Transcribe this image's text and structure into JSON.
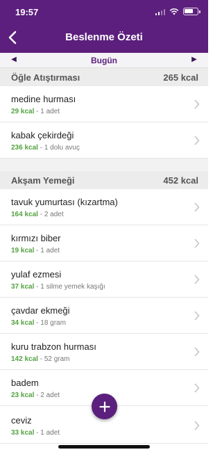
{
  "status_bar": {
    "time": "19:57",
    "battery_level": 0.7
  },
  "nav": {
    "title": "Beslenme Özeti",
    "back_icon": "chevron-left-icon"
  },
  "date_bar": {
    "label": "Bugün",
    "prev_icon": "triangle-left-icon",
    "next_icon": "triangle-right-icon"
  },
  "sections": [
    {
      "name": "Öğle Atıştırması",
      "kcal": "265 kcal",
      "items": [
        {
          "name": "medine hurması",
          "kcal": "29 kcal",
          "amount": " - 1 adet"
        },
        {
          "name": "kabak çekirdeği",
          "kcal": "236 kcal",
          "amount": " - 1 dolu avuç"
        }
      ]
    },
    {
      "name": "Akşam Yemeği",
      "kcal": "452 kcal",
      "items": [
        {
          "name": "tavuk yumurtası (kızartma)",
          "kcal": "164 kcal",
          "amount": " - 2 adet"
        },
        {
          "name": "kırmızı biber",
          "kcal": "19 kcal",
          "amount": " - 1 adet"
        },
        {
          "name": "yulaf ezmesi",
          "kcal": "37 kcal",
          "amount": " - 1 silme yemek kaşığı"
        },
        {
          "name": "çavdar ekmeği",
          "kcal": "34 kcal",
          "amount": " - 18 gram"
        },
        {
          "name": "kuru trabzon hurması",
          "kcal": "142 kcal",
          "amount": " - 52 gram"
        },
        {
          "name": "badem",
          "kcal": "23 kcal",
          "amount": " - 2 adet"
        },
        {
          "name": "ceviz",
          "kcal": "33 kcal",
          "amount": " - 1 adet"
        }
      ]
    }
  ],
  "fab": {
    "icon": "plus-icon"
  },
  "colors": {
    "brand": "#5c1f7d",
    "kcal_green": "#53a340"
  }
}
